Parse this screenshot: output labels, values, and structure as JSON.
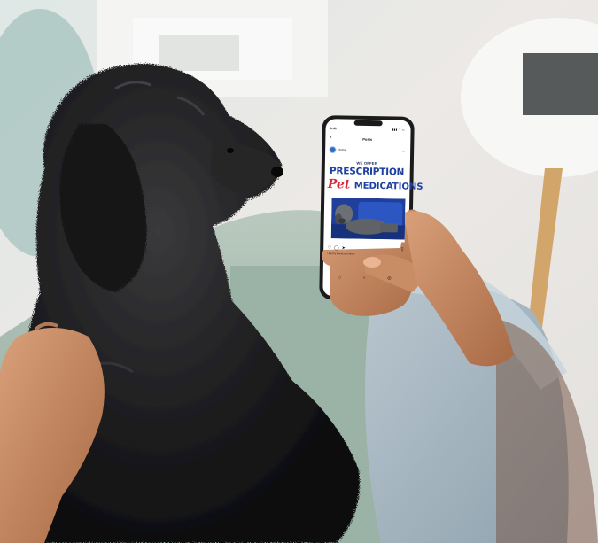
{
  "phone": {
    "status_time": "9:41",
    "status_icons": "▮▮▮ ◠ ▭",
    "nav_title": "Posts",
    "back_glyph": "‹",
    "account_name": "Home",
    "more_glyph": "···",
    "post": {
      "line1": "WE OFFER",
      "line2": "PRESCRIPTION",
      "line3a": "Pet",
      "line3b": "MEDICATIONS"
    },
    "actions": {
      "like_glyph": "♡",
      "comment_glyph": "◯",
      "share_glyph": "➤",
      "bookmark_glyph": "▯"
    },
    "caption": "Liked by friends and others",
    "tabs": {
      "home_glyph": "⌂",
      "search_glyph": "⌕",
      "profile_glyph": "◎"
    }
  },
  "colors": {
    "accent_blue": "#1e40a3",
    "accent_red": "#d52b3a"
  }
}
